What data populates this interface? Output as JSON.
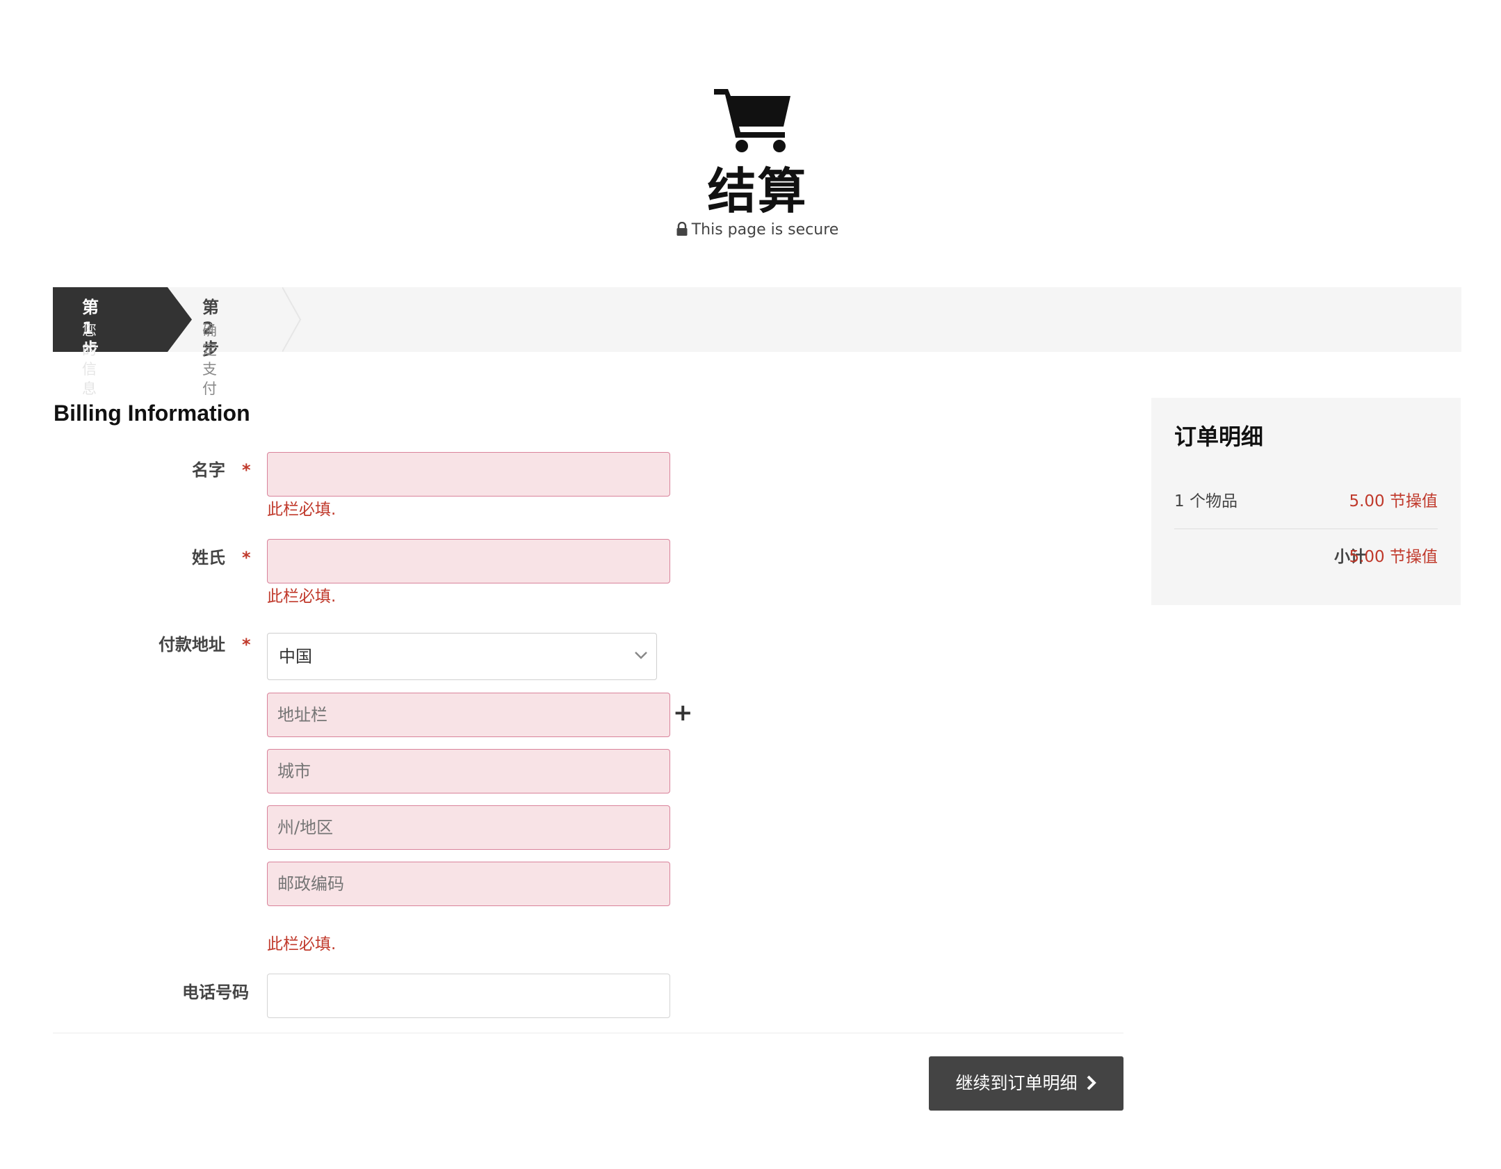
{
  "header": {
    "title": "结算",
    "secure_text": "This page is secure",
    "icons": [
      "shopping-cart-icon",
      "lock-icon"
    ]
  },
  "steps": [
    {
      "title": "第 1 步",
      "subtitle": "您的信息",
      "active": true
    },
    {
      "title": "第 2 步",
      "subtitle": "确定支付",
      "active": false
    }
  ],
  "billing": {
    "heading": "Billing Information",
    "required_marker": "*",
    "error_text": "此栏必填.",
    "first_name": {
      "label": "名字",
      "value": "",
      "placeholder": ""
    },
    "last_name": {
      "label": "姓氏",
      "value": "",
      "placeholder": ""
    },
    "address": {
      "label": "付款地址",
      "country": "中国",
      "street_placeholder": "地址栏",
      "city_placeholder": "城市",
      "state_placeholder": "州/地区",
      "zip_placeholder": "邮政编码",
      "add_line_symbol": "+"
    },
    "phone": {
      "label": "电话号码",
      "value": ""
    },
    "continue_label": "继续到订单明细"
  },
  "summary": {
    "title": "订单明细",
    "items_label": "1 个物品",
    "items_price": "5.00 节操值",
    "subtotal_label": "小计",
    "subtotal_price": "5.00 节操值"
  },
  "colors": {
    "accent_dark": "#444444",
    "error_red": "#c0392b",
    "error_field_bg": "#f8e3e6",
    "panel_bg": "#f5f5f5"
  }
}
